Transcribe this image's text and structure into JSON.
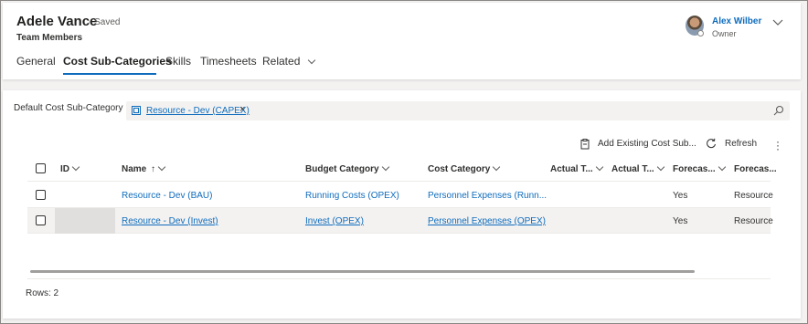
{
  "header": {
    "title": "Adele Vance",
    "saved": "- Saved",
    "entity": "Team Members",
    "owner": {
      "name": "Alex Wilber",
      "role": "Owner"
    },
    "tabs": [
      {
        "label": "General"
      },
      {
        "label": "Cost Sub-Categories",
        "active": true
      },
      {
        "label": "Skills"
      },
      {
        "label": "Timesheets"
      },
      {
        "label": "Related"
      }
    ]
  },
  "form": {
    "default_cost_label": "Default Cost Sub-Category",
    "default_cost_value": "Resource - Dev (CAPEX)",
    "remove_glyph": "×"
  },
  "commands": {
    "add_existing": "Add Existing Cost Sub...",
    "refresh": "Refresh"
  },
  "grid": {
    "columns": [
      "ID",
      "Name",
      "Budget Category",
      "Cost Category",
      "Actual T...",
      "Actual T...",
      "Forecas...",
      "Forecas..."
    ],
    "name_sort_glyph": "↑",
    "rows": [
      {
        "id": "",
        "name": "Resource - Dev (BAU)",
        "budget": "Running Costs (OPEX)",
        "cost": "Personnel Expenses (Runn...",
        "actual1": "",
        "actual2": "",
        "forecast1": "Yes",
        "forecast2": "Resource"
      },
      {
        "id": "",
        "name": "Resource - Dev (Invest)",
        "budget": "Invest (OPEX)",
        "cost": "Personnel Expenses (OPEX)",
        "actual1": "",
        "actual2": "",
        "forecast1": "Yes",
        "forecast2": "Resource"
      }
    ],
    "rows_count": "Rows: 2"
  },
  "colors": {
    "accent": "#0f6cbd",
    "text": "#323130",
    "background": "#f3f2f1"
  }
}
